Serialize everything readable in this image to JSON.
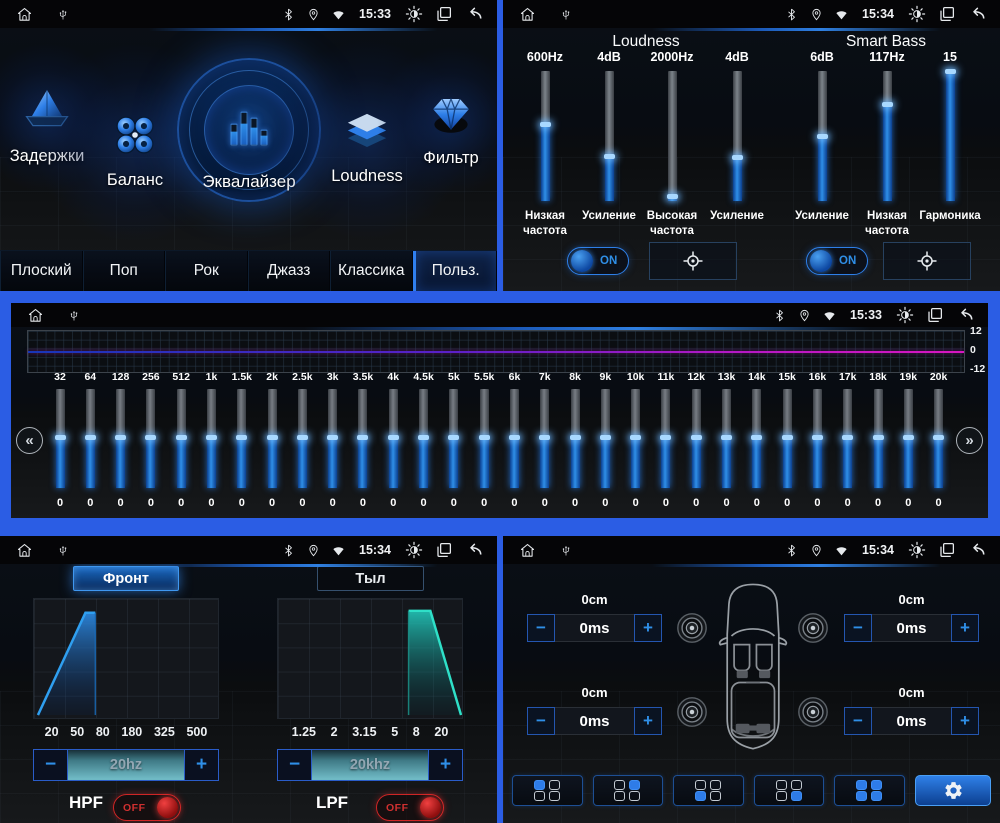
{
  "icons": {
    "chevron_left": "«",
    "chevron_right": "»",
    "minus": "−",
    "plus": "+"
  },
  "status": {
    "times": {
      "tl": "15:33",
      "tr": "15:34",
      "mid": "15:33",
      "bl": "15:34",
      "br": "15:34"
    }
  },
  "eq_home": {
    "menu": [
      {
        "label": "Задержки"
      },
      {
        "label": "Баланс"
      },
      {
        "label": "Эквалайзер"
      },
      {
        "label": "Loudness"
      },
      {
        "label": "Фильтр"
      }
    ],
    "presets": [
      {
        "label": "Плоский",
        "active": false
      },
      {
        "label": "Поп",
        "active": false
      },
      {
        "label": "Рок",
        "active": false
      },
      {
        "label": "Джазз",
        "active": false
      },
      {
        "label": "Классика",
        "active": false
      },
      {
        "label": "Польз.",
        "active": true
      }
    ]
  },
  "loudness": {
    "section_left": "Loudness",
    "section_right": "Smart Bass",
    "sliders": [
      {
        "value": "600Hz",
        "label": "Низкая частота",
        "fill": 59
      },
      {
        "value": "4dB",
        "label": "Усиление",
        "fill": 35
      },
      {
        "value": "2000Hz",
        "label": "Высокая частота",
        "fill": 4
      },
      {
        "value": "4dB",
        "label": "Усиление",
        "fill": 34
      },
      {
        "value": "6dB",
        "label": "Усиление",
        "fill": 50
      },
      {
        "value": "117Hz",
        "label": "Низкая частота",
        "fill": 75
      },
      {
        "value": "15",
        "label": "Гармоника",
        "fill": 100
      }
    ],
    "loudness_switch": "ON",
    "smartbass_switch": "ON"
  },
  "band_eq": {
    "scale_top": "12",
    "scale_mid": "0",
    "scale_bottom": "-12",
    "bands": [
      {
        "freq": "32",
        "db": "0",
        "fill": 52
      },
      {
        "freq": "64",
        "db": "0",
        "fill": 52
      },
      {
        "freq": "128",
        "db": "0",
        "fill": 52
      },
      {
        "freq": "256",
        "db": "0",
        "fill": 52
      },
      {
        "freq": "512",
        "db": "0",
        "fill": 52
      },
      {
        "freq": "1k",
        "db": "0",
        "fill": 52
      },
      {
        "freq": "1.5k",
        "db": "0",
        "fill": 52
      },
      {
        "freq": "2k",
        "db": "0",
        "fill": 52
      },
      {
        "freq": "2.5k",
        "db": "0",
        "fill": 52
      },
      {
        "freq": "3k",
        "db": "0",
        "fill": 52
      },
      {
        "freq": "3.5k",
        "db": "0",
        "fill": 52
      },
      {
        "freq": "4k",
        "db": "0",
        "fill": 52
      },
      {
        "freq": "4.5k",
        "db": "0",
        "fill": 52
      },
      {
        "freq": "5k",
        "db": "0",
        "fill": 52
      },
      {
        "freq": "5.5k",
        "db": "0",
        "fill": 52
      },
      {
        "freq": "6k",
        "db": "0",
        "fill": 52
      },
      {
        "freq": "7k",
        "db": "0",
        "fill": 52
      },
      {
        "freq": "8k",
        "db": "0",
        "fill": 52
      },
      {
        "freq": "9k",
        "db": "0",
        "fill": 52
      },
      {
        "freq": "10k",
        "db": "0",
        "fill": 52
      },
      {
        "freq": "11k",
        "db": "0",
        "fill": 52
      },
      {
        "freq": "12k",
        "db": "0",
        "fill": 52
      },
      {
        "freq": "13k",
        "db": "0",
        "fill": 52
      },
      {
        "freq": "14k",
        "db": "0",
        "fill": 52
      },
      {
        "freq": "15k",
        "db": "0",
        "fill": 52
      },
      {
        "freq": "16k",
        "db": "0",
        "fill": 52
      },
      {
        "freq": "17k",
        "db": "0",
        "fill": 52
      },
      {
        "freq": "18k",
        "db": "0",
        "fill": 52
      },
      {
        "freq": "19k",
        "db": "0",
        "fill": 52
      },
      {
        "freq": "20k",
        "db": "0",
        "fill": 52
      }
    ]
  },
  "filter": {
    "front_tab": "Фронт",
    "rear_tab": "Тыл",
    "hpf": {
      "name": "HPF",
      "state": "OFF",
      "value": "20hz",
      "ticks": [
        "20",
        "50",
        "80",
        "180",
        "325",
        "500"
      ]
    },
    "lpf": {
      "name": "LPF",
      "state": "OFF",
      "value": "20khz",
      "ticks": [
        "1.25",
        "2",
        "3.15",
        "5",
        "8",
        "20"
      ]
    }
  },
  "delay": {
    "groups": [
      {
        "position": "front-left",
        "distance": "0cm",
        "time": "0ms"
      },
      {
        "position": "front-right",
        "distance": "0cm",
        "time": "0ms"
      },
      {
        "position": "rear-left",
        "distance": "0cm",
        "time": "0ms"
      },
      {
        "position": "rear-right",
        "distance": "0cm",
        "time": "0ms"
      }
    ],
    "seat_presets": [
      {
        "fl": true,
        "fr": false,
        "rl": false,
        "rr": false
      },
      {
        "fl": false,
        "fr": true,
        "rl": false,
        "rr": false
      },
      {
        "fl": false,
        "fr": false,
        "rl": true,
        "rr": false
      },
      {
        "fl": false,
        "fr": false,
        "rl": false,
        "rr": true
      },
      {
        "fl": true,
        "fr": true,
        "rl": true,
        "rr": true
      }
    ]
  }
}
